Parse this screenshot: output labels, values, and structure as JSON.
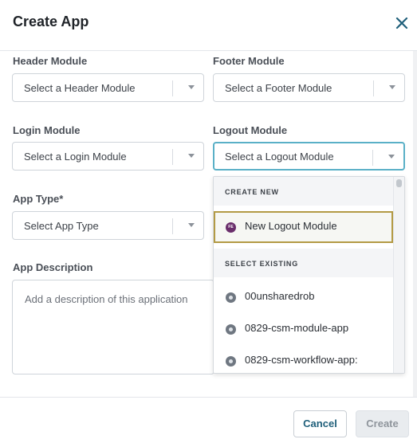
{
  "dialog": {
    "title": "Create App",
    "close_icon": "close-icon"
  },
  "form": {
    "header_module": {
      "label": "Header Module",
      "placeholder": "Select a Header Module"
    },
    "footer_module": {
      "label": "Footer Module",
      "placeholder": "Select a Footer Module"
    },
    "login_module": {
      "label": "Login Module",
      "placeholder": "Select a Login Module"
    },
    "logout_module": {
      "label": "Logout Module",
      "placeholder": "Select a Logout Module"
    },
    "app_type": {
      "label": "App Type*",
      "placeholder": "Select App Type"
    },
    "app_description": {
      "label": "App Description",
      "placeholder": "Add a description of this application"
    }
  },
  "logout_dropdown": {
    "create_new_header": "CREATE NEW",
    "new_item": {
      "label": "New Logout Module",
      "icon_text": "FE"
    },
    "select_existing_header": "SELECT EXISTING",
    "existing_items": [
      {
        "label": "00unsharedrob"
      },
      {
        "label": "0829-csm-module-app"
      },
      {
        "label": "0829-csm-workflow-app:"
      }
    ]
  },
  "footer": {
    "cancel_label": "Cancel",
    "create_label": "Create"
  },
  "colors": {
    "focus_border": "#5ab0c7",
    "highlight_border": "#b39a44",
    "cancel_text": "#1f5f7a",
    "fe_badge": "#6a2e6b"
  }
}
